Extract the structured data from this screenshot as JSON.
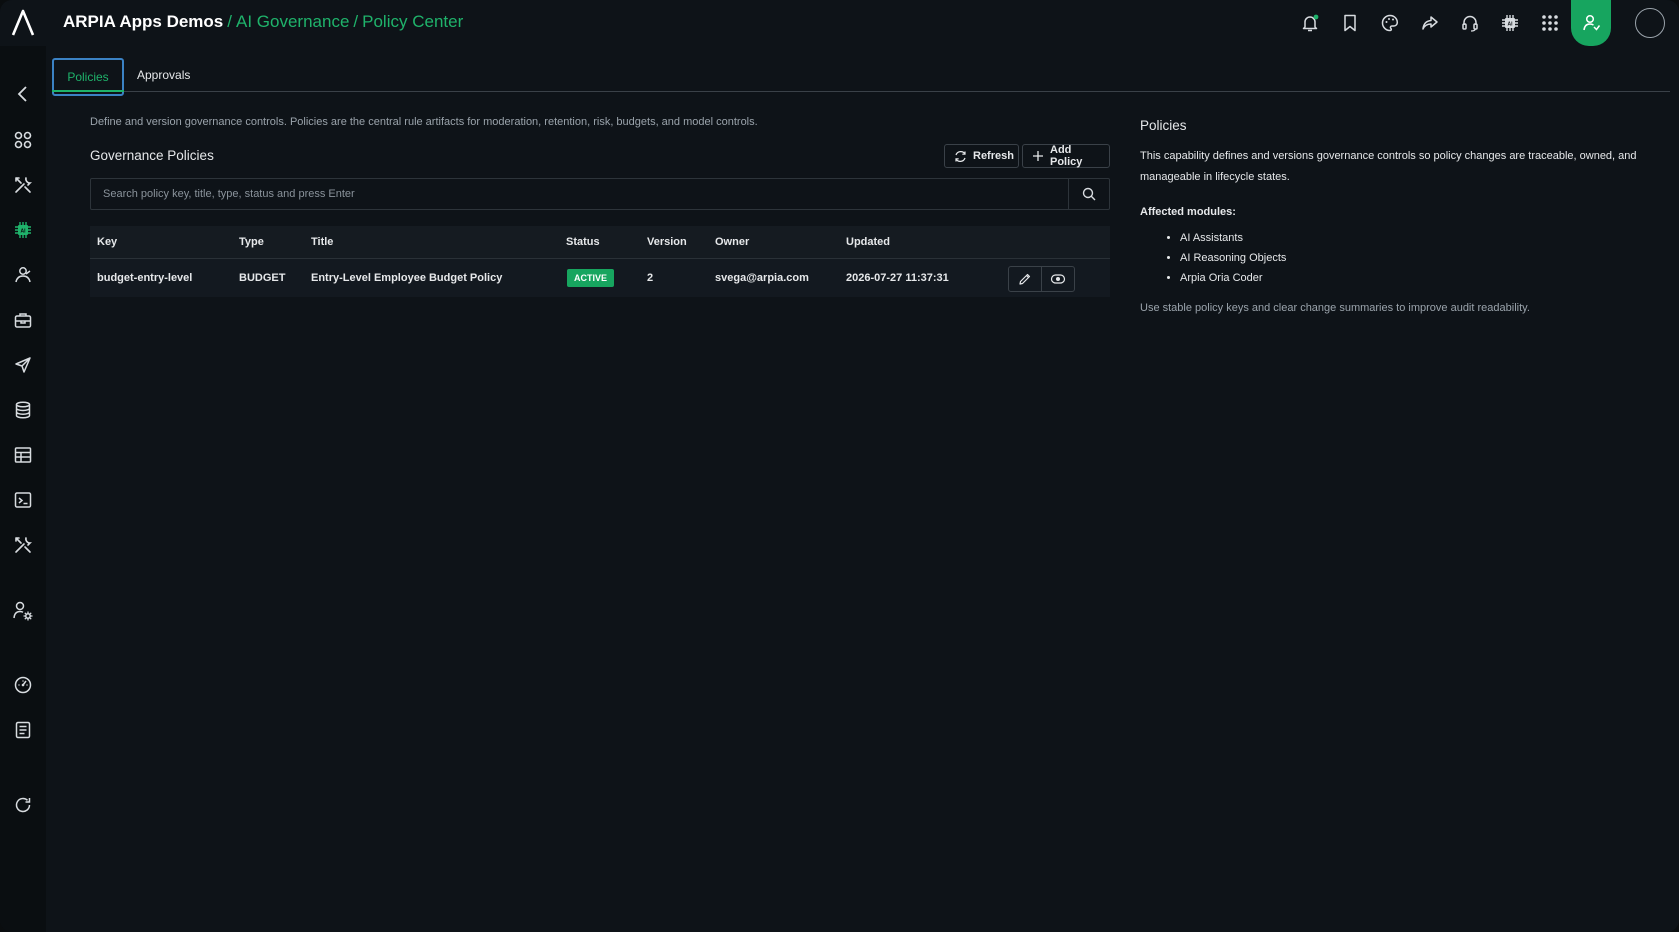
{
  "header": {
    "app_name": "ARPIA Apps Demos",
    "separator": "/",
    "crumbs": [
      "AI Governance",
      "Policy Center"
    ]
  },
  "top_icons": [
    "bell-icon",
    "bookmark-icon",
    "palette-icon",
    "share-icon",
    "headset-icon",
    "chip-icon",
    "grid-icon",
    "user-agent-icon"
  ],
  "sidebar": {
    "items": [
      "back-icon",
      "apps-icon",
      "tools-icon",
      "chip-icon",
      "agent-icon",
      "toolbox-icon",
      "send-icon",
      "database-icon",
      "table-icon",
      "terminal-icon",
      "tools-icon",
      "user-settings-icon",
      "dashboard-icon",
      "document-icon",
      "refresh-icon"
    ]
  },
  "tabs": {
    "active": "Policies",
    "other": "Approvals"
  },
  "main": {
    "description": "Define and version governance controls. Policies are the central rule artifacts for moderation, retention, risk, budgets, and model controls.",
    "section_title": "Governance Policies",
    "refresh_label": "Refresh",
    "add_label": "Add Policy",
    "search_placeholder": "Search policy key, title, type, status and press Enter",
    "columns": {
      "key": "Key",
      "type": "Type",
      "title": "Title",
      "status": "Status",
      "version": "Version",
      "owner": "Owner",
      "updated": "Updated"
    },
    "rows": [
      {
        "key": "budget-entry-level",
        "type": "BUDGET",
        "title": "Entry-Level Employee Budget Policy",
        "status": "ACTIVE",
        "version": "2",
        "owner": "svega@arpia.com",
        "updated": "2026-07-27 11:37:31"
      }
    ]
  },
  "panel": {
    "title": "Policies",
    "text": "This capability defines and versions governance controls so policy changes are traceable, owned, and manageable in lifecycle states.",
    "affected_label": "Affected modules:",
    "modules": [
      "AI Assistants",
      "AI Reasoning Objects",
      "Arpia Oria Coder"
    ],
    "note": "Use stable policy keys and clear change summaries to improve audit readability."
  },
  "colors": {
    "accent": "#1fb36b",
    "tab_focus": "#3b82c4",
    "background": "#0e1318"
  }
}
